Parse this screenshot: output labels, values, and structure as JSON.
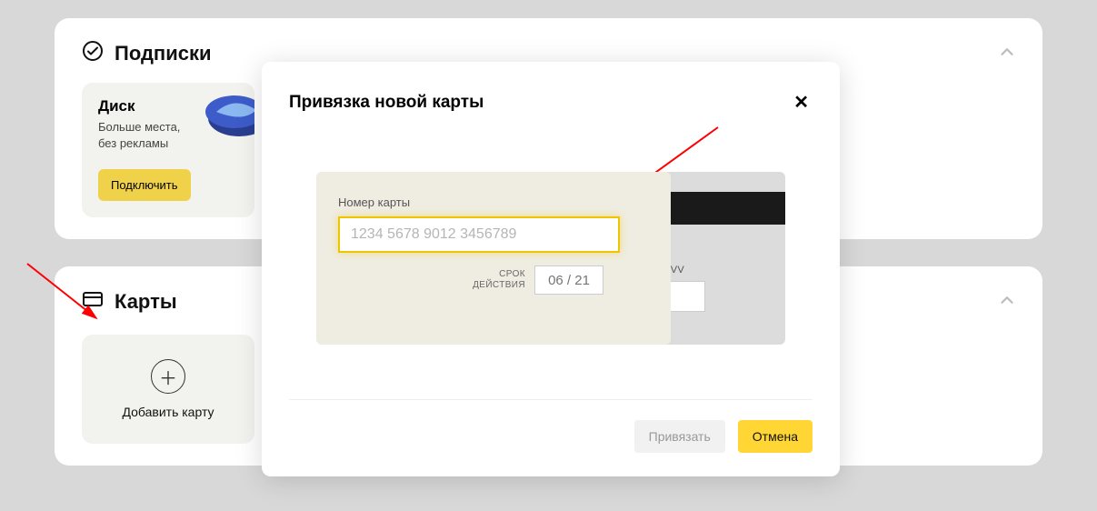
{
  "subscriptions": {
    "title": "Подписки",
    "disk": {
      "name": "Диск",
      "subtitle": "Больше места,\nбез рекламы",
      "button": "Подключить"
    }
  },
  "cards": {
    "title": "Карты",
    "add_label": "Добавить карту"
  },
  "modal": {
    "title": "Привязка новой карты",
    "card_number_label": "Номер карты",
    "card_number_placeholder": "1234 5678 9012 3456789",
    "expiry_label": "СРОК\nДЕЙСТВИЯ",
    "expiry_placeholder": "06 / 21",
    "cvc_label": "CVC/CVV",
    "bind_button": "Привязать",
    "cancel_button": "Отмена"
  },
  "colors": {
    "accent_yellow": "#ffd633",
    "input_focus": "#f0c400"
  }
}
